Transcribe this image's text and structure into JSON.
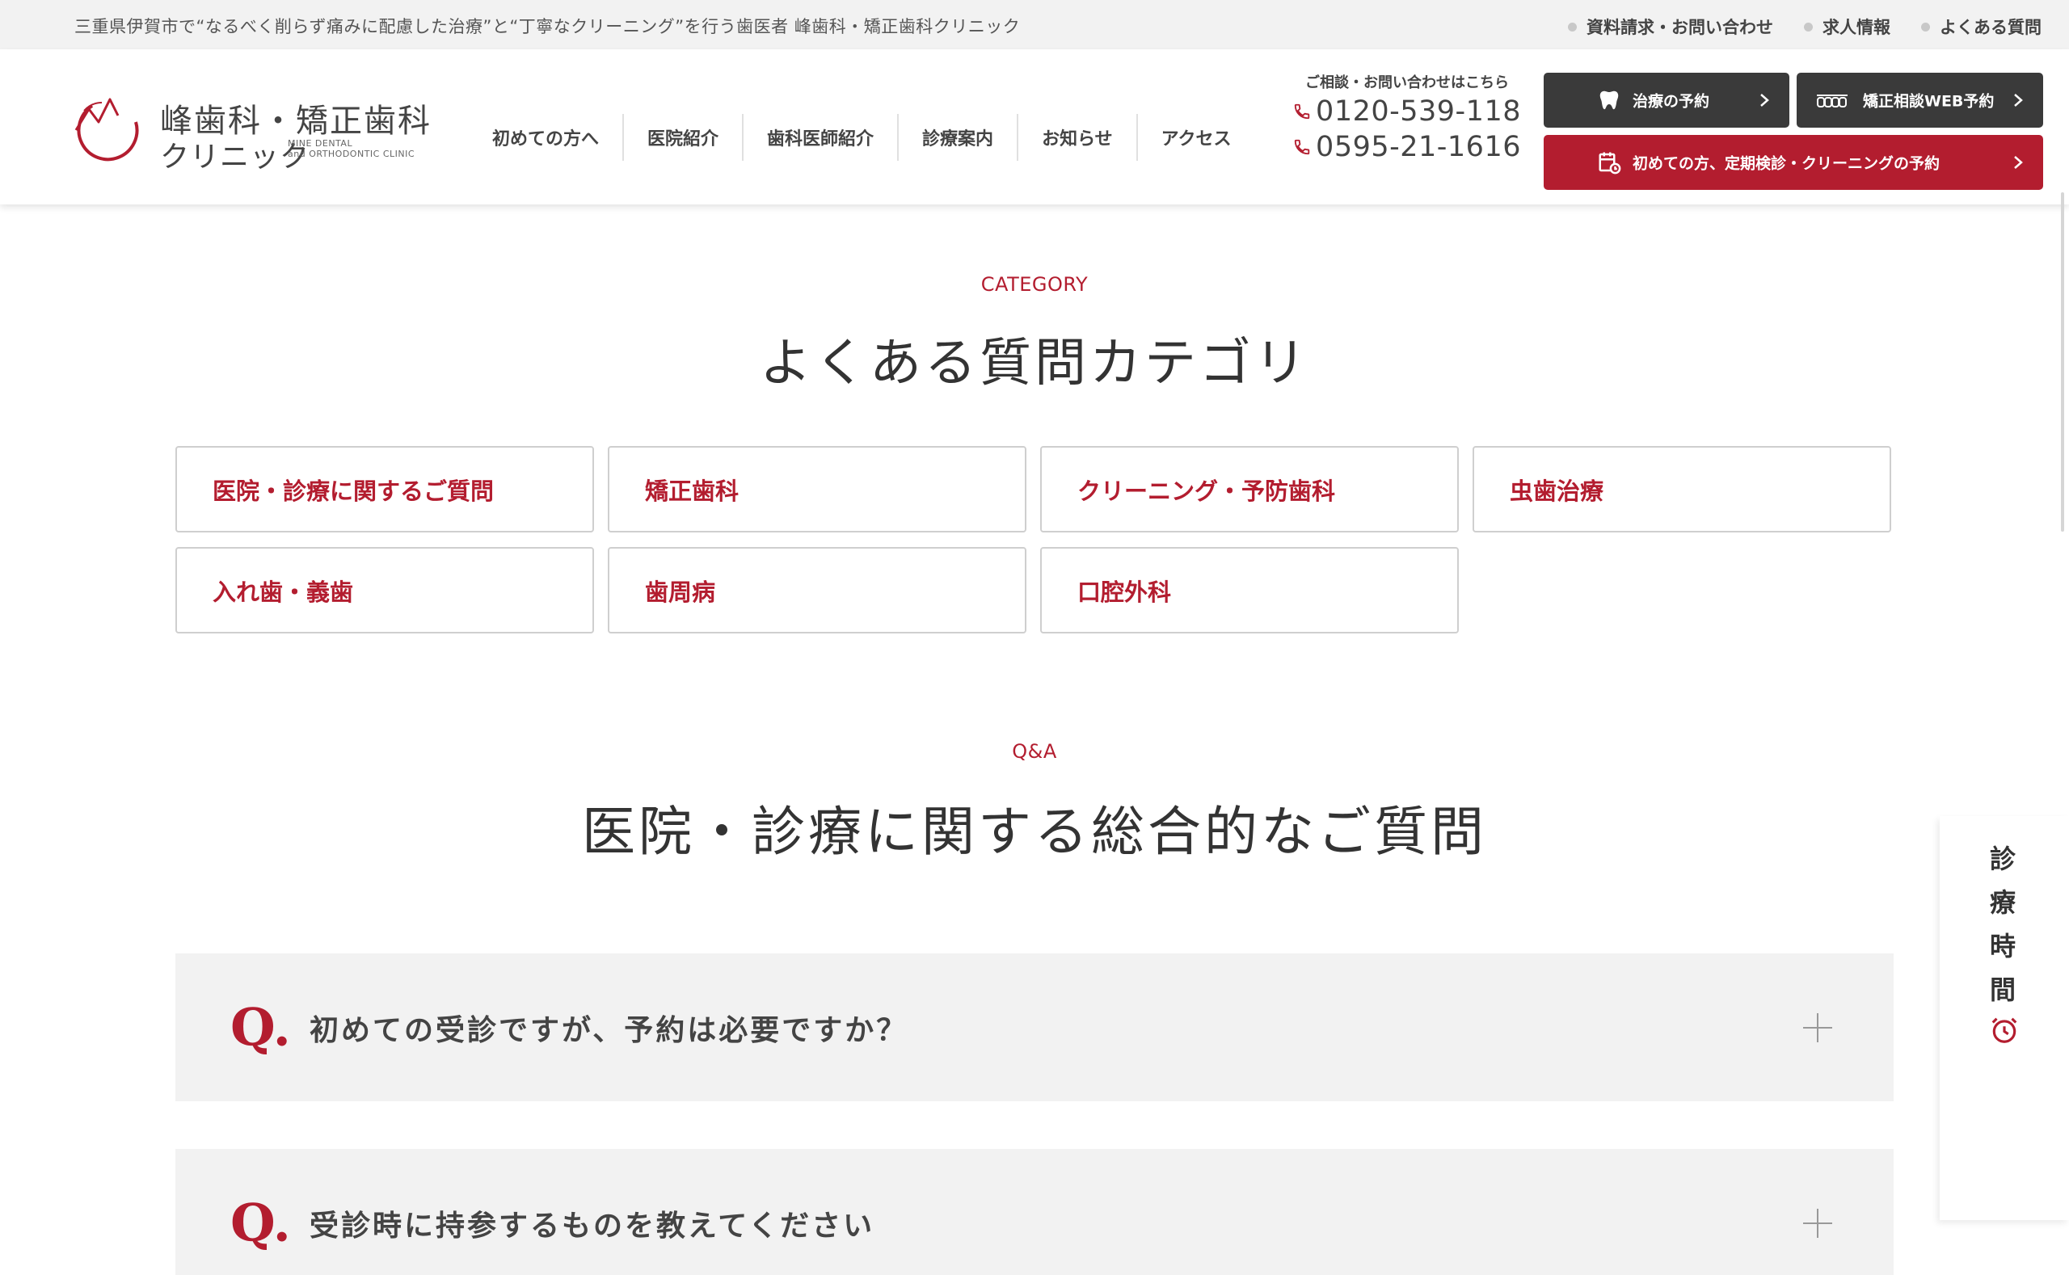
{
  "topbar": {
    "tagline": "三重県伊賀市で“なるべく削らず痛みに配慮した治療”と“丁寧なクリーニング”を行う歯医者 峰歯科・矯正歯科クリニック",
    "links": [
      "資料請求・お問い合わせ",
      "求人情報",
      "よくある質問"
    ]
  },
  "logo": {
    "name_line1": "峰歯科・矯正歯科",
    "name_line2": "クリニック",
    "name_en_line1": "MINE DENTAL",
    "name_en_line2": "and ORTHODONTIC CLINIC"
  },
  "nav": [
    "初めての方へ",
    "医院紹介",
    "歯科医師紹介",
    "診療案内",
    "お知らせ",
    "アクセス"
  ],
  "contact": {
    "caption": "ご相談・お問い合わせはこちら",
    "phones": [
      "0120-539-118",
      "0595-21-1616"
    ]
  },
  "buttons": {
    "treatment": "治療の予約",
    "ortho": "矯正相談WEB予約",
    "first": "初めての方、定期検診・クリーニングの予約"
  },
  "category": {
    "eyebrow": "CATEGORY",
    "heading": "よくある質問カテゴリ",
    "items": [
      "医院・診療に関するご質問",
      "矯正歯科",
      "クリーニング・予防歯科",
      "虫歯治療",
      "入れ歯・義歯",
      "歯周病",
      "口腔外科"
    ]
  },
  "qa": {
    "eyebrow": "Q&A",
    "heading": "医院・診療に関する総合的なご質問",
    "q_mark": "Q.",
    "questions": [
      "初めての受診ですが、予約は必要ですか？",
      "受診時に持参するものを教えてください"
    ]
  },
  "side_tab": {
    "label": "診療時間"
  },
  "colors": {
    "accent": "#b31d2f",
    "dark_button": "#3a3a3a",
    "panel_bg": "#f2f2f2"
  }
}
